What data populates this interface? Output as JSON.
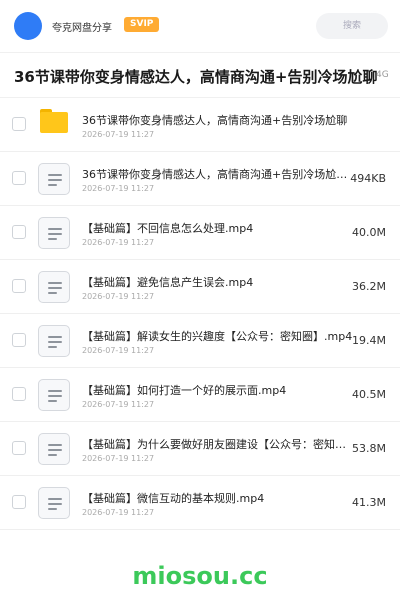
{
  "header": {
    "site_name": "夸克网盘分享",
    "badge": "SVIP",
    "search_placeholder": "搜索"
  },
  "folder_title": {
    "text": "36节课带你变身情感达人，高情商沟通+告别冷场尬聊",
    "size": "4G"
  },
  "items": [
    {
      "type": "folder",
      "name": "36节课带你变身情感达人，高情商沟通+告别冷场尬聊",
      "date": "2026-07-19 11:27",
      "size": ""
    },
    {
      "type": "file",
      "name": "36节课带你变身情感达人，高情商沟通+告别冷场尬聊...",
      "date": "2026-07-19 11:27",
      "size": "494KB"
    },
    {
      "type": "file",
      "name": "【基础篇】不回信息怎么处理.mp4",
      "date": "2026-07-19 11:27",
      "size": "40.0M"
    },
    {
      "type": "file",
      "name": "【基础篇】避免信息产生误会.mp4",
      "date": "2026-07-19 11:27",
      "size": "36.2M"
    },
    {
      "type": "file",
      "name": "【基础篇】解读女生的兴趣度【公众号：密知圈】.mp4",
      "date": "2026-07-19 11:27",
      "size": "19.4M"
    },
    {
      "type": "file",
      "name": "【基础篇】如何打造一个好的展示面.mp4",
      "date": "2026-07-19 11:27",
      "size": "40.5M"
    },
    {
      "type": "file",
      "name": "【基础篇】为什么要做好朋友圈建设【公众号：密知圈】",
      "date": "2026-07-19 11:27",
      "size": "53.8M"
    },
    {
      "type": "file",
      "name": "【基础篇】微信互动的基本规则.mp4",
      "date": "2026-07-19 11:27",
      "size": "41.3M"
    }
  ],
  "watermark": "miosou.cc"
}
